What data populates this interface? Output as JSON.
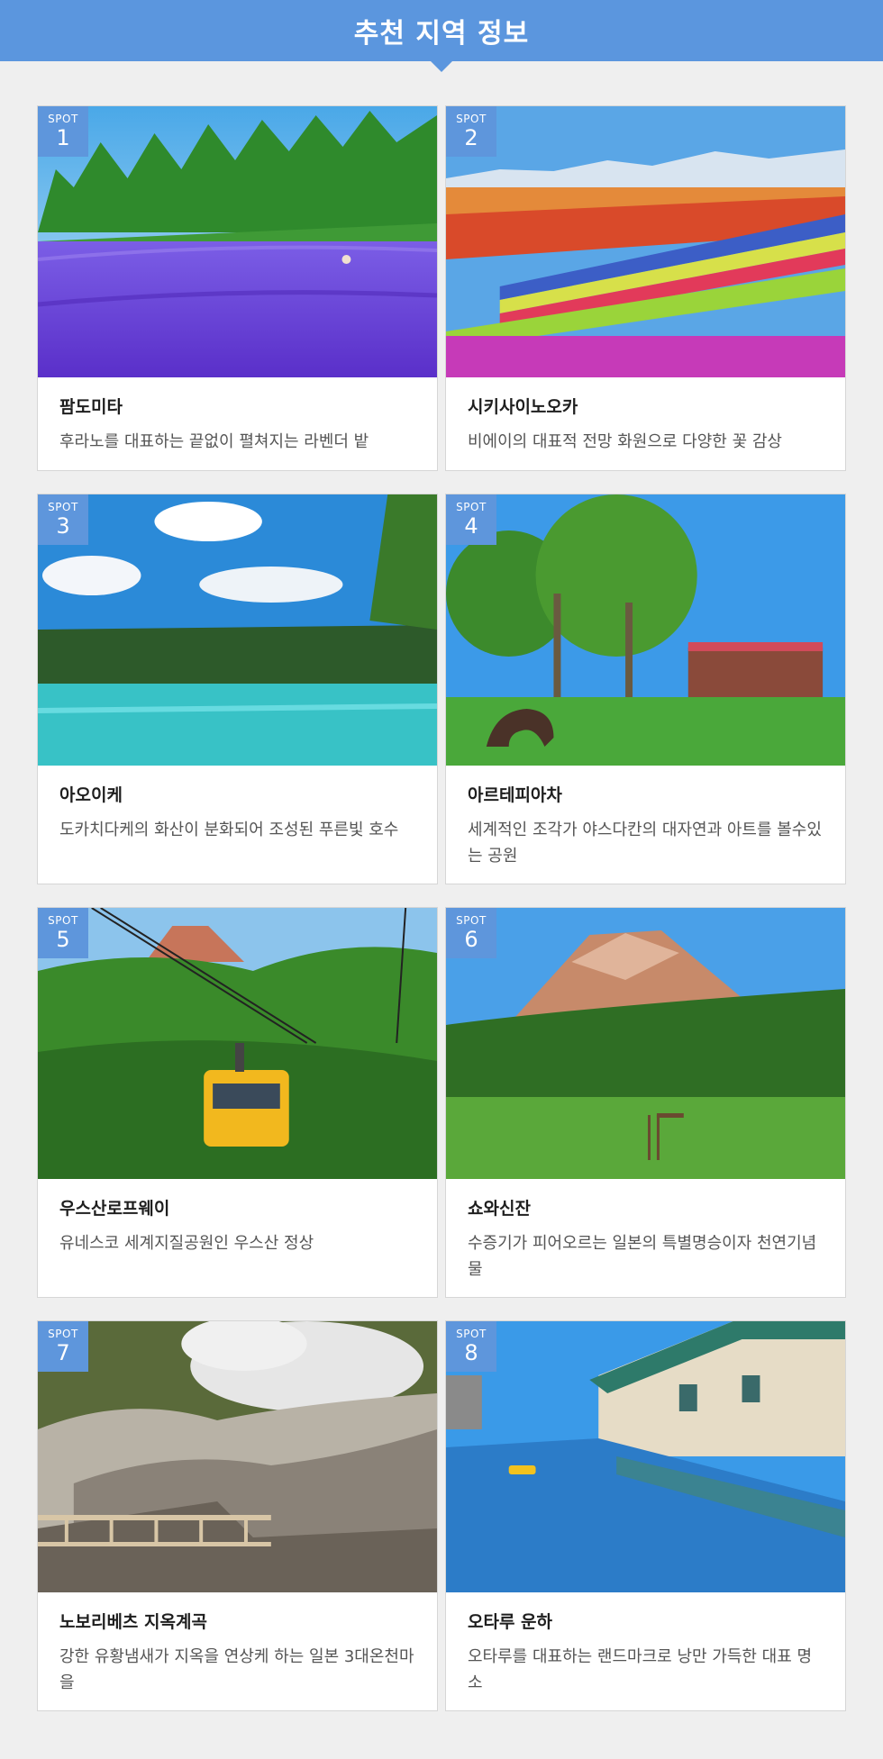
{
  "header": {
    "title": "추천 지역 정보"
  },
  "spot_label": "SPOT",
  "spots": [
    {
      "number": "1",
      "name": "팜도미타",
      "desc": "후라노를 대표하는 끝없이 펼쳐지는 라벤더 밭"
    },
    {
      "number": "2",
      "name": "시키사이노오카",
      "desc": "비에이의 대표적 전망 화원으로 다양한 꽃 감상"
    },
    {
      "number": "3",
      "name": "아오이케",
      "desc": "도카치다케의 화산이 분화되어 조성된 푸른빛 호수"
    },
    {
      "number": "4",
      "name": "아르테피아차",
      "desc": "세계적인 조각가 야스다칸의 대자연과 아트를 볼수있는 공원"
    },
    {
      "number": "5",
      "name": "우스산로프웨이",
      "desc": "유네스코 세계지질공원인 우스산 정상"
    },
    {
      "number": "6",
      "name": "쇼와신잔",
      "desc": "수증기가 피어오르는 일본의 특별명승이자 천연기념물"
    },
    {
      "number": "7",
      "name": "노보리베츠 지옥계곡",
      "desc": "강한 유황냄새가 지옥을 연상케 하는 일본 3대온천마을"
    },
    {
      "number": "8",
      "name": "오타루 운하",
      "desc": "오타루를 대표하는 랜드마크로 낭만 가득한 대표 명소"
    }
  ],
  "colors": {
    "header": "#5b96de",
    "spot_badge": "#5e96dc",
    "background": "#efefef"
  }
}
